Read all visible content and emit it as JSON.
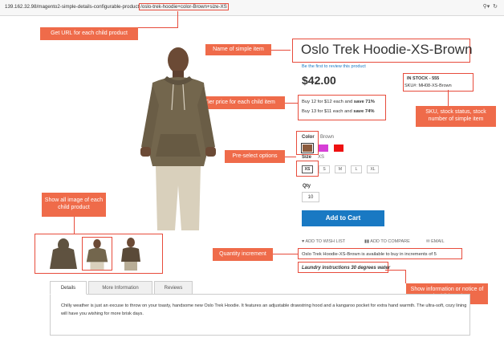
{
  "browser": {
    "url_prefix": "139.162.32.98/magento2-simple-details-configurable-product",
    "url_highlight": "/oslo-trek-hoodie+color-Brown+size-XS"
  },
  "callouts": {
    "url": "Get URL for each child product",
    "name": "Name of simple item",
    "tier": "Tier price for each child item",
    "sku": "SKU, stock status, stock number of simple item",
    "preselect": "Pre-select options",
    "images": "Show all image of each child product",
    "qty": "Quantity increment",
    "info": "Show information or notice of each child product"
  },
  "product": {
    "name": "Oslo Trek Hoodie-XS-Brown",
    "review_link": "Be the first to review this product",
    "price": "$42.00",
    "stock": "IN STOCK - 555",
    "sku_label": "SKU#:",
    "sku_value": "MH08-XS-Brown",
    "tier1_text": "Buy 12 for $12 each and ",
    "tier1_save": "save 71%",
    "tier2_text": "Buy 13 for $11 each and ",
    "tier2_save": "save 74%",
    "color_label": "Color",
    "color_value": "Brown",
    "swatches": [
      "#8b5a3c",
      "#d63fd6",
      "#ee1111"
    ],
    "size_label": "Size",
    "size_value": "XS",
    "sizes": [
      "XS",
      "S",
      "M",
      "L",
      "XL"
    ],
    "qty_label": "Qty",
    "qty_value": "10",
    "add_to_cart": "Add to Cart",
    "wishlist": "ADD TO WISH LIST",
    "compare": "ADD TO COMPARE",
    "email": "EMAIL",
    "qty_note": "Oslo Trek Hoodie-XS-Brown is available to buy in increments of 5",
    "laundry": "Laundry instructions 30 degrees water"
  },
  "tabs": {
    "details": "Details",
    "more_info": "More Information",
    "reviews": "Reviews",
    "description": "Chilly weather is just an excuse to throw on your toasty, handsome new Oslo Trek Hoodie. It features an adjustable drawstring hood and a kangaroo pocket for extra hand warmth. The ultra-soft, cozy lining will have you wishing for more brisk days."
  }
}
